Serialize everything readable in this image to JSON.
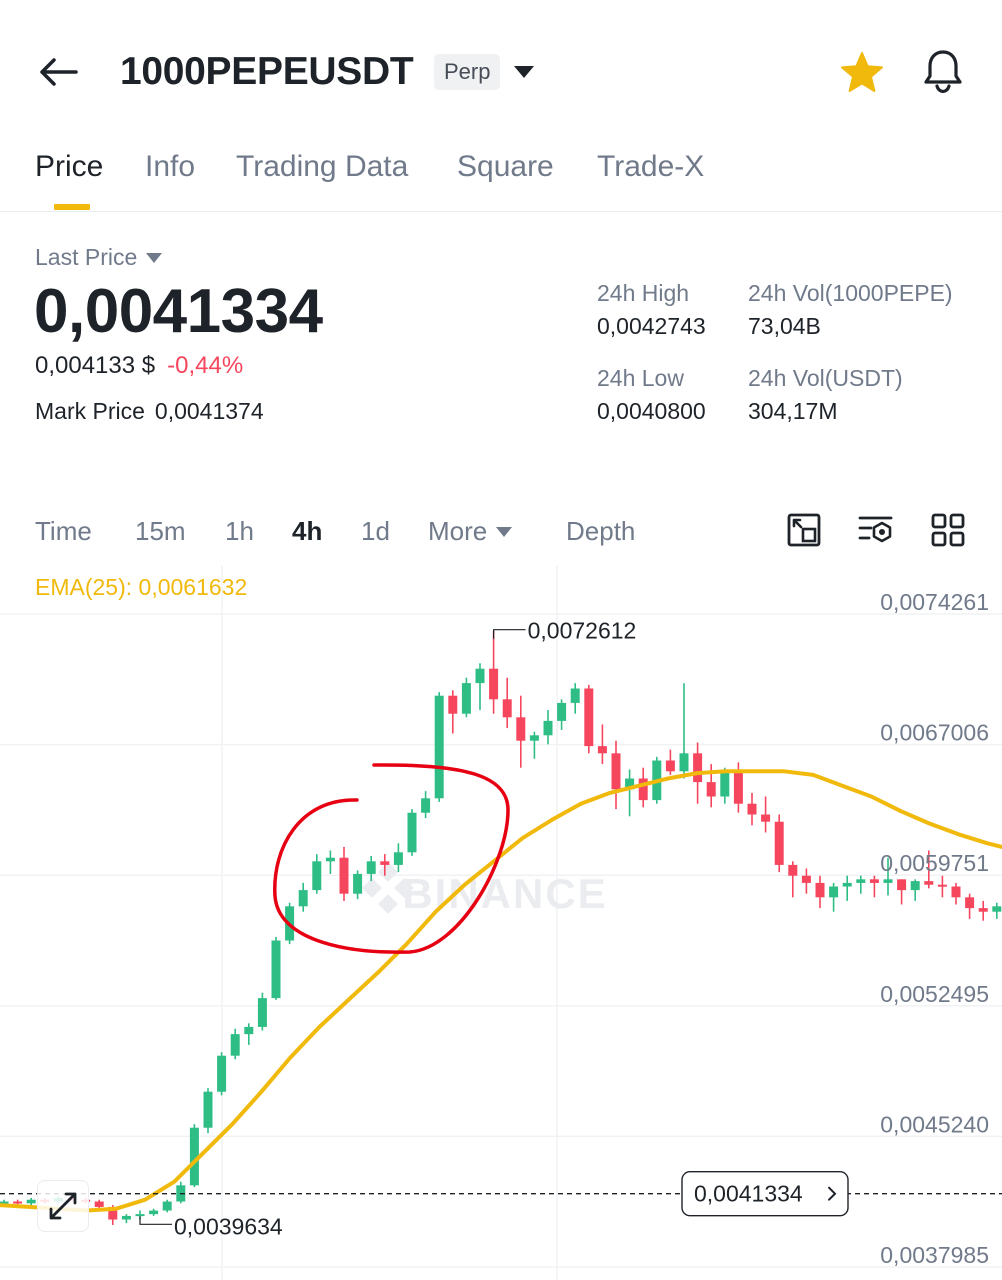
{
  "header": {
    "symbol": "1000PEPEUSDT",
    "badge": "Perp"
  },
  "tabs": [
    {
      "label": "Price",
      "active": true
    },
    {
      "label": "Info"
    },
    {
      "label": "Trading Data"
    },
    {
      "label": "Square"
    },
    {
      "label": "Trade-X"
    }
  ],
  "price": {
    "last_price_label": "Last Price",
    "last_price": "0,0041334",
    "usd_price": "0,004133 $",
    "change": "-0,44%",
    "mark_label": "Mark Price",
    "mark_price": "0,0041374"
  },
  "stats": {
    "high_label": "24h High",
    "high": "0,0042743",
    "low_label": "24h Low",
    "low": "0,0040800",
    "vol_base_label": "24h Vol(1000PEPE)",
    "vol_base": "73,04B",
    "vol_quote_label": "24h Vol(USDT)",
    "vol_quote": "304,17M"
  },
  "intervals": {
    "time": "Time",
    "m15": "15m",
    "h1": "1h",
    "h4": "4h",
    "d1": "1d",
    "more": "More",
    "depth": "Depth",
    "active": "4h"
  },
  "colors": {
    "up": "#2ebd85",
    "down": "#f6465d",
    "accent": "#f0b90b",
    "annotation": "#e60012"
  },
  "chart_data": {
    "type": "candlestick",
    "indicator_label": "EMA(25): 0,0061632",
    "watermark": "BINANCE",
    "y_ticks": [
      "0,0074261",
      "0,0067006",
      "0,0059751",
      "0,0052495",
      "0,0045240",
      "0,0037985"
    ],
    "y_tick_values": [
      0.0074261,
      0.0067006,
      0.0059751,
      0.0052495,
      0.004524,
      0.0037985
    ],
    "high_marker": "0,0072612",
    "high_marker_value": 0.0072612,
    "low_marker": "0,0039634",
    "low_marker_value": 0.0039634,
    "current_price_label": "0,0041334",
    "current_price_value": 0.0041334,
    "candles": [
      [
        0.00409,
        0.0041,
        0.00408,
        0.00409
      ],
      [
        0.00409,
        0.0041,
        0.00407,
        0.00408
      ],
      [
        0.00408,
        0.00411,
        0.00407,
        0.0041
      ],
      [
        0.0041,
        0.00411,
        0.00408,
        0.00409
      ],
      [
        0.00409,
        0.00412,
        0.00408,
        0.00411
      ],
      [
        0.00411,
        0.00413,
        0.00409,
        0.0041
      ],
      [
        0.0041,
        0.00411,
        0.00408,
        0.00409
      ],
      [
        0.00409,
        0.0041,
        0.00405,
        0.00406
      ],
      [
        0.00406,
        0.00407,
        0.00396,
        0.00399
      ],
      [
        0.00399,
        0.00402,
        0.00397,
        0.00401
      ],
      [
        0.00401,
        0.00404,
        0.00399,
        0.00402
      ],
      [
        0.00402,
        0.00405,
        0.00401,
        0.00404
      ],
      [
        0.00404,
        0.0041,
        0.00403,
        0.00409
      ],
      [
        0.00409,
        0.0042,
        0.00408,
        0.00418
      ],
      [
        0.00418,
        0.00452,
        0.00417,
        0.0045
      ],
      [
        0.0045,
        0.00472,
        0.00447,
        0.0047
      ],
      [
        0.0047,
        0.00492,
        0.00468,
        0.0049
      ],
      [
        0.0049,
        0.00505,
        0.00488,
        0.00502
      ],
      [
        0.00502,
        0.00508,
        0.00496,
        0.00506
      ],
      [
        0.00506,
        0.00525,
        0.00504,
        0.00522
      ],
      [
        0.00522,
        0.00556,
        0.00521,
        0.00554
      ],
      [
        0.00554,
        0.00575,
        0.00552,
        0.00573
      ],
      [
        0.00573,
        0.00586,
        0.0057,
        0.00582
      ],
      [
        0.00582,
        0.00602,
        0.0058,
        0.00598
      ],
      [
        0.00598,
        0.00604,
        0.00591,
        0.006
      ],
      [
        0.006,
        0.00606,
        0.00576,
        0.0058
      ],
      [
        0.0058,
        0.00593,
        0.00577,
        0.00591
      ],
      [
        0.00591,
        0.00601,
        0.00587,
        0.00598
      ],
      [
        0.00598,
        0.00602,
        0.0059,
        0.00596
      ],
      [
        0.00596,
        0.00608,
        0.00592,
        0.00603
      ],
      [
        0.00603,
        0.00627,
        0.00601,
        0.00625
      ],
      [
        0.00625,
        0.00637,
        0.00622,
        0.00633
      ],
      [
        0.00633,
        0.00692,
        0.00631,
        0.0069
      ],
      [
        0.0069,
        0.00693,
        0.00669,
        0.0068
      ],
      [
        0.0068,
        0.007,
        0.00678,
        0.00697
      ],
      [
        0.00697,
        0.00708,
        0.00682,
        0.00705
      ],
      [
        0.00705,
        0.00726,
        0.0068,
        0.00688
      ],
      [
        0.00688,
        0.007,
        0.00672,
        0.00678
      ],
      [
        0.00678,
        0.0069,
        0.0065,
        0.00665
      ],
      [
        0.00665,
        0.0067,
        0.00655,
        0.00668
      ],
      [
        0.00668,
        0.00682,
        0.00663,
        0.00676
      ],
      [
        0.00676,
        0.00688,
        0.00671,
        0.00686
      ],
      [
        0.00686,
        0.00697,
        0.0068,
        0.00694
      ],
      [
        0.00694,
        0.00696,
        0.00658,
        0.00662
      ],
      [
        0.00662,
        0.00674,
        0.00652,
        0.00658
      ],
      [
        0.00658,
        0.00665,
        0.00627,
        0.00638
      ],
      [
        0.00638,
        0.00649,
        0.00623,
        0.00644
      ],
      [
        0.00644,
        0.0065,
        0.00628,
        0.00632
      ],
      [
        0.00632,
        0.00656,
        0.0063,
        0.00654
      ],
      [
        0.00654,
        0.0066,
        0.00646,
        0.00648
      ],
      [
        0.00648,
        0.00697,
        0.00644,
        0.00658
      ],
      [
        0.00658,
        0.00664,
        0.0063,
        0.00642
      ],
      [
        0.00642,
        0.00652,
        0.00628,
        0.00634
      ],
      [
        0.00634,
        0.0065,
        0.0063,
        0.00648
      ],
      [
        0.00648,
        0.00653,
        0.00625,
        0.0063
      ],
      [
        0.0063,
        0.00636,
        0.00618,
        0.00624
      ],
      [
        0.00624,
        0.00634,
        0.00614,
        0.0062
      ],
      [
        0.0062,
        0.00624,
        0.00592,
        0.00596
      ],
      [
        0.00596,
        0.00598,
        0.00578,
        0.0059
      ],
      [
        0.0059,
        0.00594,
        0.0058,
        0.00586
      ],
      [
        0.00586,
        0.0059,
        0.00572,
        0.00578
      ],
      [
        0.00578,
        0.00586,
        0.0057,
        0.00584
      ],
      [
        0.00584,
        0.0059,
        0.00576,
        0.00586
      ],
      [
        0.00586,
        0.0059,
        0.0058,
        0.00588
      ],
      [
        0.00588,
        0.0059,
        0.00578,
        0.00586
      ],
      [
        0.00586,
        0.006,
        0.00579,
        0.00588
      ],
      [
        0.00588,
        0.00588,
        0.00574,
        0.00582
      ],
      [
        0.00582,
        0.00588,
        0.00576,
        0.00587
      ],
      [
        0.00587,
        0.00604,
        0.00583,
        0.00585
      ],
      [
        0.00585,
        0.0059,
        0.00578,
        0.00584
      ],
      [
        0.00584,
        0.00586,
        0.00574,
        0.00578
      ],
      [
        0.00578,
        0.0058,
        0.00566,
        0.00572
      ],
      [
        0.00572,
        0.00576,
        0.00565,
        0.0057
      ],
      [
        0.0057,
        0.00575,
        0.00566,
        0.00573
      ],
      [
        0.00573,
        0.00576,
        0.00569,
        0.00574
      ],
      [
        0.00574,
        0.00576,
        0.00566,
        0.0057
      ],
      [
        0.0057,
        0.00574,
        0.00564,
        0.00572
      ]
    ],
    "ema": [
      0.00407,
      0.00406,
      0.00405,
      0.00404,
      0.00405,
      0.0041,
      0.0042,
      0.00436,
      0.00452,
      0.0047,
      0.00489,
      0.00506,
      0.00521,
      0.00536,
      0.00552,
      0.0057,
      0.00585,
      0.00598,
      0.00611,
      0.00621,
      0.0063,
      0.00636,
      0.0064,
      0.00644,
      0.00647,
      0.00648,
      0.00648,
      0.00648,
      0.00646,
      0.0064,
      0.00634,
      0.00626,
      0.00619,
      0.00613,
      0.00608,
      0.00604,
      0.00598
    ]
  }
}
